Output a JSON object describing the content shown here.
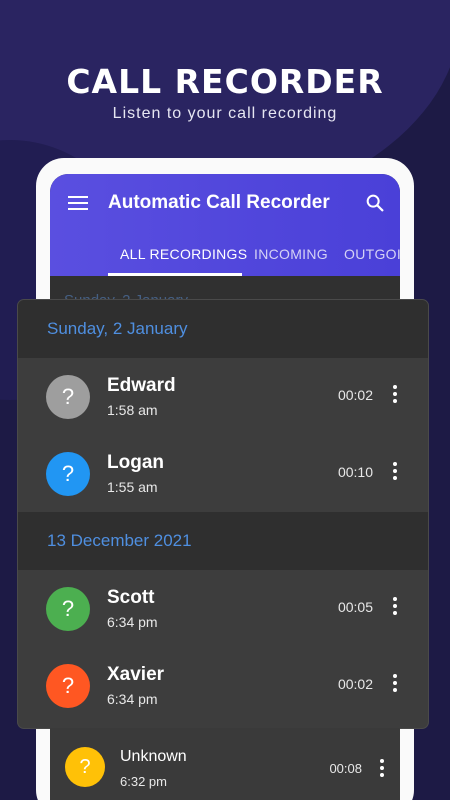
{
  "hero": {
    "title": "CALL RECORDER",
    "subtitle": "Listen to your call recording"
  },
  "app": {
    "title": "Automatic Call Recorder",
    "tabs": [
      {
        "label": "ALL RECORDINGS",
        "active": true
      },
      {
        "label": "INCOMING",
        "active": false
      },
      {
        "label": "OUTGOING",
        "active": false
      }
    ],
    "peek_date": "Sunday, 2 January"
  },
  "groups": [
    {
      "date": "Sunday, 2 January",
      "recordings": [
        {
          "name": "Edward",
          "time": "1:58 am",
          "duration": "00:02",
          "avatar_color": "#9e9e9e",
          "avatar_glyph": "?"
        },
        {
          "name": "Logan",
          "time": "1:55 am",
          "duration": "00:10",
          "avatar_color": "#2196f3",
          "avatar_glyph": "?"
        }
      ]
    },
    {
      "date": "13 December 2021",
      "recordings": [
        {
          "name": "Scott",
          "time": "6:34 pm",
          "duration": "00:05",
          "avatar_color": "#4caf50",
          "avatar_glyph": "?"
        },
        {
          "name": "Xavier",
          "time": "6:34 pm",
          "duration": "00:02",
          "avatar_color": "#ff5722",
          "avatar_glyph": "?"
        }
      ]
    }
  ],
  "below_card": {
    "name": "Unknown",
    "time": "6:32 pm",
    "duration": "00:08",
    "avatar_color": "#ffc107",
    "avatar_glyph": "?"
  },
  "colors": {
    "background": "#1d1a45",
    "appbar": "#5a4fe0",
    "date_accent": "#4f8fe0",
    "card": "#3d3d3d"
  }
}
